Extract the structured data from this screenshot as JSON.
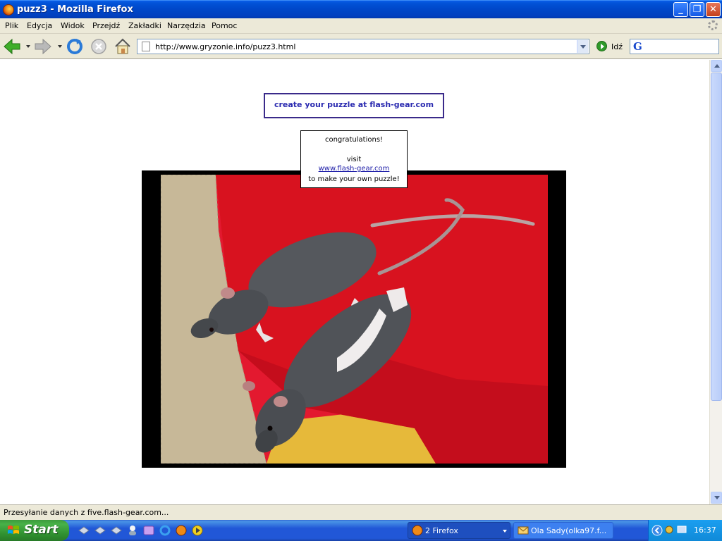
{
  "window": {
    "title": "puzz3 - Mozilla Firefox",
    "buttons": [
      "minimize",
      "maximize",
      "close"
    ]
  },
  "menubar": {
    "items": [
      "Plik",
      "Edycja",
      "Widok",
      "Przejdź",
      "Zakładki",
      "Narzędzia",
      "Pomoc"
    ]
  },
  "toolbar": {
    "url": "http://www.gryzonie.info/puzz3.html",
    "go_label": "Idź",
    "icons": [
      "back-icon",
      "forward-icon",
      "reload-icon",
      "stop-icon",
      "home-icon"
    ]
  },
  "page": {
    "banner_text": "create your puzzle at flash-gear.com",
    "popup": {
      "line1": "congratulations!",
      "line2": "visit",
      "link": "www.flash-gear.com",
      "line3": "to make your own puzzle!"
    },
    "image_subject": "two rats on a red cushion"
  },
  "status": {
    "text": "Przesyłanie danych z five.flash-gear.com..."
  },
  "taskbar": {
    "start_label": "Start",
    "tasks": [
      {
        "label": "2 Firefox"
      },
      {
        "label": "Ola Sady(olka97.f..."
      }
    ],
    "clock": "16:37"
  },
  "colors": {
    "titlebar": "#0047c8",
    "banner_text": "#2a2ab0",
    "banner_border": "#3a2a8a",
    "cushion_red": "#e3192f"
  }
}
